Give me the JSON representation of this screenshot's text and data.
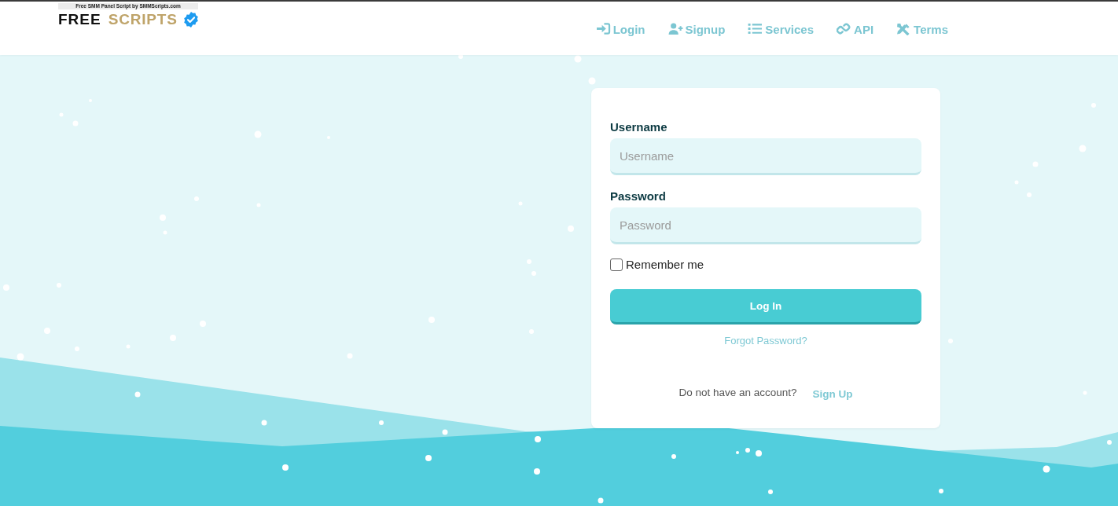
{
  "header": {
    "logo": {
      "tagline": "Free SMM Panel Script by SMMScripts.com",
      "word_1": "FREE",
      "word_2": "SCRIPTS"
    },
    "nav": [
      {
        "label": "Login"
      },
      {
        "label": "Signup"
      },
      {
        "label": "Services"
      },
      {
        "label": "API"
      },
      {
        "label": "Terms"
      }
    ]
  },
  "login_form": {
    "fields": [
      {
        "label": "Username",
        "placeholder": "Username"
      },
      {
        "label": "Password",
        "placeholder": "Password"
      }
    ],
    "remember": {
      "label": "Remember me",
      "checked": false
    },
    "submit": "Log In",
    "forgot_link": "Forgot Password?",
    "signup_prompt": "Do not have an account?",
    "signup_link": "Sign Up"
  }
}
